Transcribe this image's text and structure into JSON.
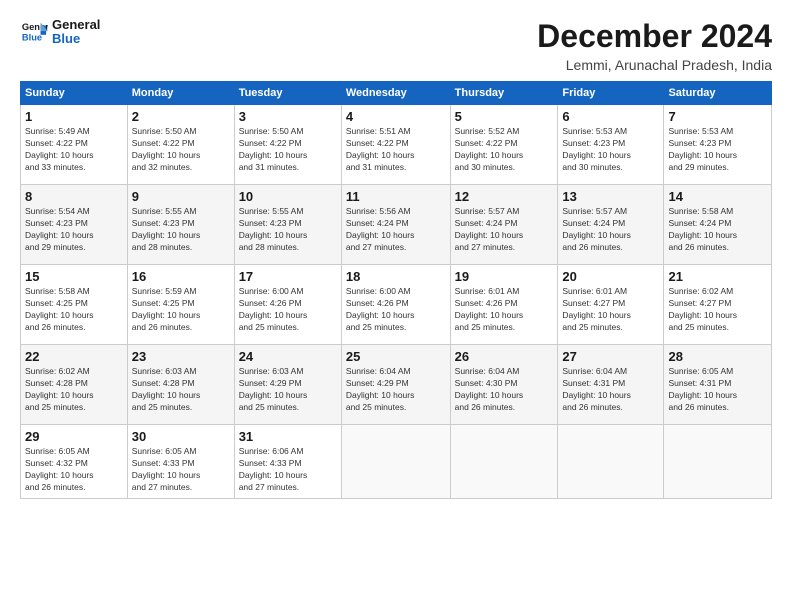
{
  "header": {
    "logo_line1": "General",
    "logo_line2": "Blue",
    "title": "December 2024",
    "subtitle": "Lemmi, Arunachal Pradesh, India"
  },
  "weekdays": [
    "Sunday",
    "Monday",
    "Tuesday",
    "Wednesday",
    "Thursday",
    "Friday",
    "Saturday"
  ],
  "weeks": [
    [
      {
        "day": "1",
        "sunrise": "5:49 AM",
        "sunset": "4:22 PM",
        "daylight": "10 hours and 33 minutes."
      },
      {
        "day": "2",
        "sunrise": "5:50 AM",
        "sunset": "4:22 PM",
        "daylight": "10 hours and 32 minutes."
      },
      {
        "day": "3",
        "sunrise": "5:50 AM",
        "sunset": "4:22 PM",
        "daylight": "10 hours and 31 minutes."
      },
      {
        "day": "4",
        "sunrise": "5:51 AM",
        "sunset": "4:22 PM",
        "daylight": "10 hours and 31 minutes."
      },
      {
        "day": "5",
        "sunrise": "5:52 AM",
        "sunset": "4:22 PM",
        "daylight": "10 hours and 30 minutes."
      },
      {
        "day": "6",
        "sunrise": "5:53 AM",
        "sunset": "4:23 PM",
        "daylight": "10 hours and 30 minutes."
      },
      {
        "day": "7",
        "sunrise": "5:53 AM",
        "sunset": "4:23 PM",
        "daylight": "10 hours and 29 minutes."
      }
    ],
    [
      {
        "day": "8",
        "sunrise": "5:54 AM",
        "sunset": "4:23 PM",
        "daylight": "10 hours and 29 minutes."
      },
      {
        "day": "9",
        "sunrise": "5:55 AM",
        "sunset": "4:23 PM",
        "daylight": "10 hours and 28 minutes."
      },
      {
        "day": "10",
        "sunrise": "5:55 AM",
        "sunset": "4:23 PM",
        "daylight": "10 hours and 28 minutes."
      },
      {
        "day": "11",
        "sunrise": "5:56 AM",
        "sunset": "4:24 PM",
        "daylight": "10 hours and 27 minutes."
      },
      {
        "day": "12",
        "sunrise": "5:57 AM",
        "sunset": "4:24 PM",
        "daylight": "10 hours and 27 minutes."
      },
      {
        "day": "13",
        "sunrise": "5:57 AM",
        "sunset": "4:24 PM",
        "daylight": "10 hours and 26 minutes."
      },
      {
        "day": "14",
        "sunrise": "5:58 AM",
        "sunset": "4:24 PM",
        "daylight": "10 hours and 26 minutes."
      }
    ],
    [
      {
        "day": "15",
        "sunrise": "5:58 AM",
        "sunset": "4:25 PM",
        "daylight": "10 hours and 26 minutes."
      },
      {
        "day": "16",
        "sunrise": "5:59 AM",
        "sunset": "4:25 PM",
        "daylight": "10 hours and 26 minutes."
      },
      {
        "day": "17",
        "sunrise": "6:00 AM",
        "sunset": "4:26 PM",
        "daylight": "10 hours and 25 minutes."
      },
      {
        "day": "18",
        "sunrise": "6:00 AM",
        "sunset": "4:26 PM",
        "daylight": "10 hours and 25 minutes."
      },
      {
        "day": "19",
        "sunrise": "6:01 AM",
        "sunset": "4:26 PM",
        "daylight": "10 hours and 25 minutes."
      },
      {
        "day": "20",
        "sunrise": "6:01 AM",
        "sunset": "4:27 PM",
        "daylight": "10 hours and 25 minutes."
      },
      {
        "day": "21",
        "sunrise": "6:02 AM",
        "sunset": "4:27 PM",
        "daylight": "10 hours and 25 minutes."
      }
    ],
    [
      {
        "day": "22",
        "sunrise": "6:02 AM",
        "sunset": "4:28 PM",
        "daylight": "10 hours and 25 minutes."
      },
      {
        "day": "23",
        "sunrise": "6:03 AM",
        "sunset": "4:28 PM",
        "daylight": "10 hours and 25 minutes."
      },
      {
        "day": "24",
        "sunrise": "6:03 AM",
        "sunset": "4:29 PM",
        "daylight": "10 hours and 25 minutes."
      },
      {
        "day": "25",
        "sunrise": "6:04 AM",
        "sunset": "4:29 PM",
        "daylight": "10 hours and 25 minutes."
      },
      {
        "day": "26",
        "sunrise": "6:04 AM",
        "sunset": "4:30 PM",
        "daylight": "10 hours and 26 minutes."
      },
      {
        "day": "27",
        "sunrise": "6:04 AM",
        "sunset": "4:31 PM",
        "daylight": "10 hours and 26 minutes."
      },
      {
        "day": "28",
        "sunrise": "6:05 AM",
        "sunset": "4:31 PM",
        "daylight": "10 hours and 26 minutes."
      }
    ],
    [
      {
        "day": "29",
        "sunrise": "6:05 AM",
        "sunset": "4:32 PM",
        "daylight": "10 hours and 26 minutes."
      },
      {
        "day": "30",
        "sunrise": "6:05 AM",
        "sunset": "4:33 PM",
        "daylight": "10 hours and 27 minutes."
      },
      {
        "day": "31",
        "sunrise": "6:06 AM",
        "sunset": "4:33 PM",
        "daylight": "10 hours and 27 minutes."
      },
      null,
      null,
      null,
      null
    ]
  ]
}
